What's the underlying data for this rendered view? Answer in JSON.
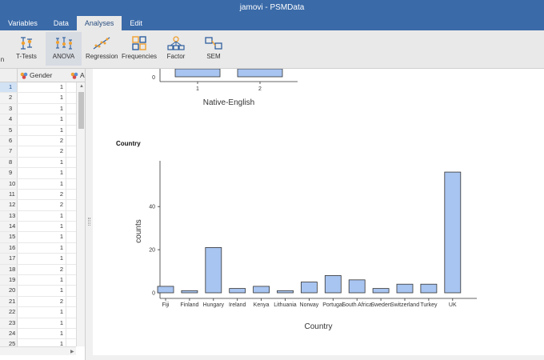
{
  "app": {
    "title": "jamovi - PSMData"
  },
  "tabs": [
    {
      "label": "Variables",
      "active": false
    },
    {
      "label": "Data",
      "active": false
    },
    {
      "label": "Analyses",
      "active": true
    },
    {
      "label": "Edit",
      "active": false
    }
  ],
  "ribbon": [
    {
      "label": "n",
      "icon": "exploration-icon"
    },
    {
      "label": "T-Tests",
      "icon": "t-test-icon"
    },
    {
      "label": "ANOVA",
      "icon": "anova-icon",
      "active": true
    },
    {
      "label": "Regression",
      "icon": "regression-icon"
    },
    {
      "label": "Frequencies",
      "icon": "frequencies-icon"
    },
    {
      "label": "Factor",
      "icon": "factor-icon"
    },
    {
      "label": "SEM",
      "icon": "sem-icon"
    }
  ],
  "sheet": {
    "column_gender": "Gender",
    "column_next": "A",
    "selected_row": 1,
    "rows": [
      {
        "n": "1",
        "gender": "1"
      },
      {
        "n": "2",
        "gender": "1"
      },
      {
        "n": "3",
        "gender": "1"
      },
      {
        "n": "4",
        "gender": "1"
      },
      {
        "n": "5",
        "gender": "1"
      },
      {
        "n": "6",
        "gender": "2"
      },
      {
        "n": "7",
        "gender": "2"
      },
      {
        "n": "8",
        "gender": "1"
      },
      {
        "n": "9",
        "gender": "1"
      },
      {
        "n": "10",
        "gender": "1"
      },
      {
        "n": "11",
        "gender": "2"
      },
      {
        "n": "12",
        "gender": "2"
      },
      {
        "n": "13",
        "gender": "1"
      },
      {
        "n": "14",
        "gender": "1"
      },
      {
        "n": "15",
        "gender": "1"
      },
      {
        "n": "16",
        "gender": "1"
      },
      {
        "n": "17",
        "gender": "1"
      },
      {
        "n": "18",
        "gender": "2"
      },
      {
        "n": "19",
        "gender": "1"
      },
      {
        "n": "20",
        "gender": "1"
      },
      {
        "n": "21",
        "gender": "2"
      },
      {
        "n": "22",
        "gender": "1"
      },
      {
        "n": "23",
        "gender": "1"
      },
      {
        "n": "24",
        "gender": "1"
      },
      {
        "n": "25",
        "gender": "1"
      }
    ]
  },
  "results": {
    "country_heading": "Country"
  },
  "chart_data": [
    {
      "type": "bar",
      "categories": [
        "1",
        "2"
      ],
      "y_tick_visible": "0",
      "xlabel": "Native-English",
      "ylabel": "",
      "partial": "bottom of chart only, top clipped by scroll"
    },
    {
      "type": "bar",
      "categories": [
        "Fiji",
        "Finland",
        "Hungary",
        "Ireland",
        "Kenya",
        "Lithuania",
        "Norway",
        "Portugal",
        "South Africa",
        "Sweden",
        "Switzerland",
        "Turkey",
        "UK"
      ],
      "values": [
        3,
        1,
        21,
        2,
        3,
        1,
        5,
        8,
        6,
        2,
        4,
        4,
        56
      ],
      "xlabel": "Country",
      "ylabel": "counts",
      "yticks": [
        0,
        20,
        40
      ],
      "ylim": [
        0,
        59
      ],
      "bar_color": "#a8c4f0",
      "bar_stroke": "#333333"
    }
  ]
}
